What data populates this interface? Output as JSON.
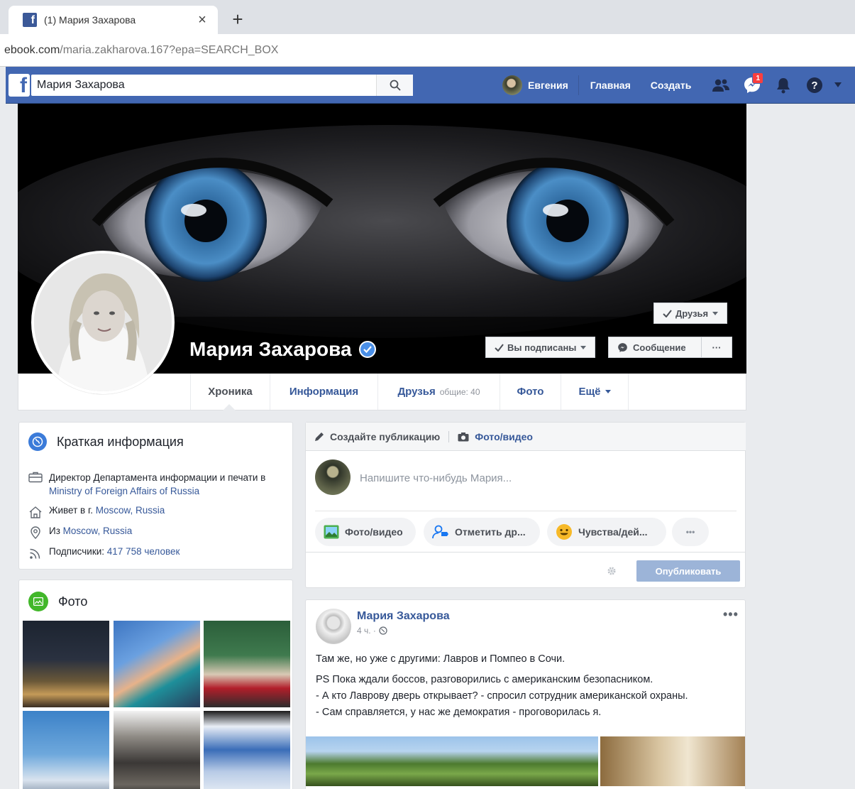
{
  "browser": {
    "tab_title": "(1) Мария Захарова",
    "url_host": "ebook.com",
    "url_path": "/maria.zakharova.167?epa=SEARCH_BOX"
  },
  "nav": {
    "search_value": "Мария Захарова",
    "user_name": "Евгения",
    "home": "Главная",
    "create": "Создать",
    "messages_badge": "1"
  },
  "profile": {
    "name": "Мария Захарова",
    "friends_button": "Друзья",
    "following_button": "Вы подписаны",
    "message_button": "Сообщение",
    "more_button": "···"
  },
  "timeline_nav": {
    "items": [
      {
        "label": "Хроника"
      },
      {
        "label": "Информация"
      },
      {
        "label": "Друзья",
        "sub": "общие: 40"
      },
      {
        "label": "Фото"
      },
      {
        "label": "Ещё"
      }
    ]
  },
  "intro": {
    "title": "Краткая информация",
    "work_prefix": "Директор Департамента информации и печати в",
    "work_link": "Ministry of Foreign Affairs of Russia",
    "lives_prefix": "Живет в г.",
    "lives_link": "Moscow, Russia",
    "from_prefix": "Из",
    "from_link": "Moscow, Russia",
    "followers_prefix": "Подписчики:",
    "followers_link": "417 758 человек"
  },
  "photos": {
    "title": "Фото"
  },
  "composer": {
    "create_post": "Создайте публикацию",
    "photo_video": "Фото/видео",
    "placeholder": "Напишите что-нибудь Мария...",
    "pill_photo": "Фото/видео",
    "pill_tag": "Отметить др...",
    "pill_feeling": "Чувства/дей...",
    "pill_more": "•••",
    "publish": "Опубликовать"
  },
  "post": {
    "author": "Мария Захарова",
    "time": "4 ч. ·",
    "line1": "Там же, но уже с другими: Лавров и Помпео в Сочи.",
    "line2": "PS Пока ждали боссов, разговорились с американским безопасником.",
    "line3": "- А кто Лаврову дверь открывает? - спросил сотрудник американской охраны.",
    "line4": "- Сам справляется, у нас же демократия - проговорилась я."
  },
  "colors": {
    "fb_blue": "#4267b2",
    "link": "#365899",
    "page_bg": "#e9ebee"
  }
}
